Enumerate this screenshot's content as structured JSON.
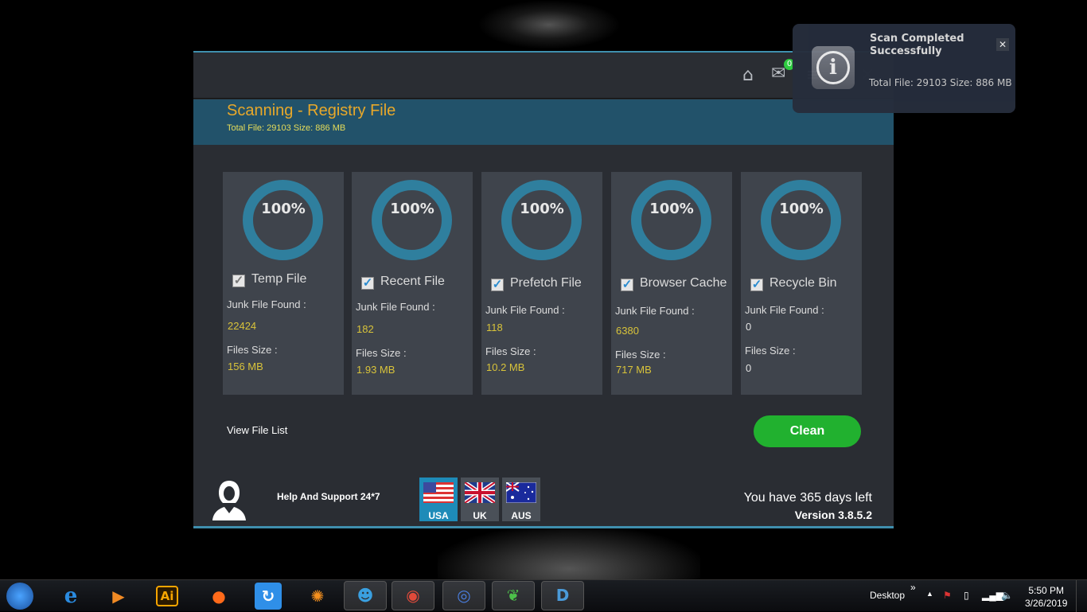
{
  "app": {
    "notification_count": "0",
    "banner": {
      "title": "Scanning - Registry File",
      "subtitle": "Total File: 29103 Size: 886 MB"
    },
    "cards": [
      {
        "label": "Temp File",
        "percent": "100%",
        "checked": true,
        "junk_label": "Junk File Found :",
        "junk": "22424",
        "size_label": "Files Size :",
        "size": "156 MB"
      },
      {
        "label": "Recent File",
        "percent": "100%",
        "checked": true,
        "junk_label": "Junk File Found :",
        "junk": "182",
        "size_label": "Files Size :",
        "size": "1.93 MB"
      },
      {
        "label": "Prefetch File",
        "percent": "100%",
        "checked": true,
        "junk_label": "Junk File Found :",
        "junk": "118",
        "size_label": "Files Size :",
        "size": "10.2 MB"
      },
      {
        "label": "Browser Cache",
        "percent": "100%",
        "checked": true,
        "junk_label": "Junk File Found :",
        "junk": "6380",
        "size_label": "Files Size :",
        "size": "717 MB"
      },
      {
        "label": "Recycle Bin",
        "percent": "100%",
        "checked": true,
        "junk_label": "Junk File Found :",
        "junk": "0",
        "size_label": "Files Size :",
        "size": "0"
      }
    ],
    "view_file_list": "View File List",
    "clean_label": "Clean",
    "help": "Help And Support 24*7",
    "regions": [
      {
        "label": "USA",
        "selected": true
      },
      {
        "label": "UK",
        "selected": false
      },
      {
        "label": "AUS",
        "selected": false
      }
    ],
    "days_left": "You have 365 days left",
    "version": "Version 3.8.5.2",
    "colors": {
      "accent": "#2f7f9e",
      "title": "#e8a82a",
      "value": "#d8c33a",
      "clean": "#21b12f"
    }
  },
  "toast": {
    "title": "Scan Completed Successfully",
    "message": "Total File: 29103 Size: 886 MB"
  },
  "taskbar": {
    "desktop": "Desktop",
    "time": "5:50 PM",
    "date": "3/26/2019"
  }
}
